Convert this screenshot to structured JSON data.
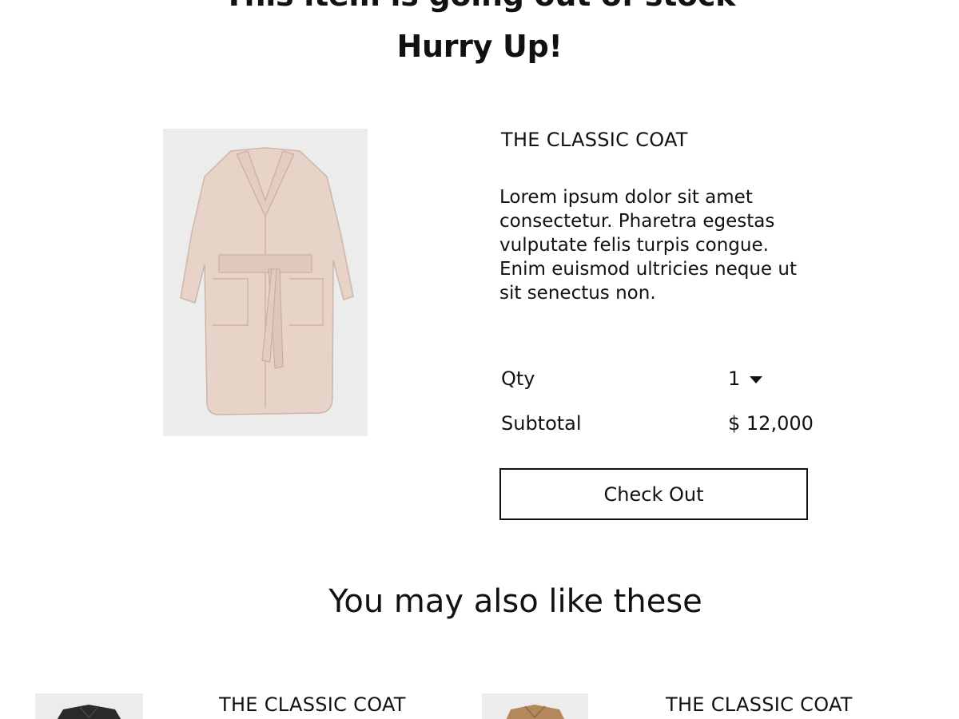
{
  "header": {
    "line1": "This item is going out of stock",
    "line2": "Hurry Up!"
  },
  "product": {
    "name": "THE CLASSIC COAT",
    "description": "Lorem ipsum dolor sit amet consectetur. Pharetra egestas vulputate felis turpis congue. Enim euismod ultricies neque ut sit senectus non.",
    "image_icon": "coat-image",
    "qty_label": "Qty",
    "qty_value": "1",
    "subtotal_label": "Subtotal",
    "subtotal_value": "$ 12,000",
    "checkout_label": "Check Out",
    "coat_color": "#e8d3c9"
  },
  "recommendations": {
    "title": "You may also like these",
    "items": [
      {
        "name": "THE CLASSIC COAT",
        "coat_color": "#2a2a2a"
      },
      {
        "name": "THE CLASSIC COAT",
        "coat_color": "#b5875c"
      }
    ]
  }
}
